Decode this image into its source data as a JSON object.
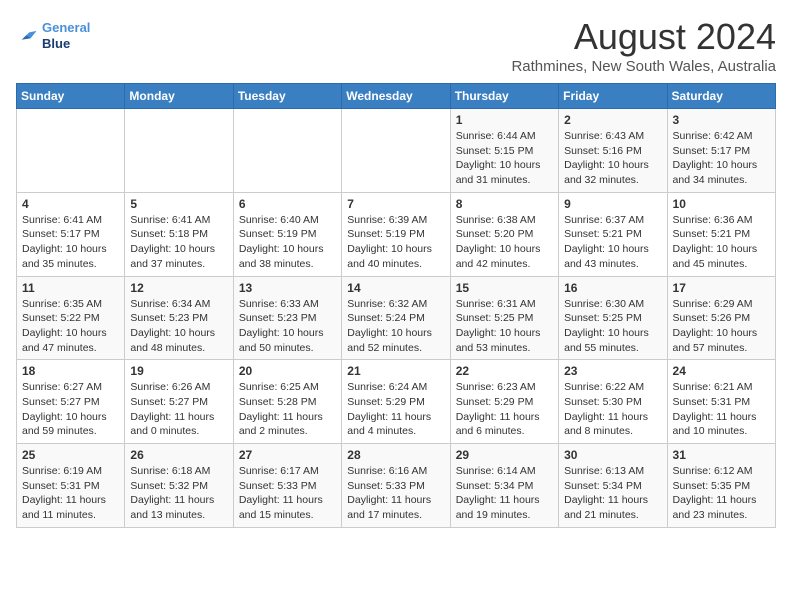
{
  "header": {
    "logo_line1": "General",
    "logo_line2": "Blue",
    "title": "August 2024",
    "subtitle": "Rathmines, New South Wales, Australia"
  },
  "calendar": {
    "days_of_week": [
      "Sunday",
      "Monday",
      "Tuesday",
      "Wednesday",
      "Thursday",
      "Friday",
      "Saturday"
    ],
    "weeks": [
      [
        {
          "day": "",
          "info": ""
        },
        {
          "day": "",
          "info": ""
        },
        {
          "day": "",
          "info": ""
        },
        {
          "day": "",
          "info": ""
        },
        {
          "day": "1",
          "info": "Sunrise: 6:44 AM\nSunset: 5:15 PM\nDaylight: 10 hours\nand 31 minutes."
        },
        {
          "day": "2",
          "info": "Sunrise: 6:43 AM\nSunset: 5:16 PM\nDaylight: 10 hours\nand 32 minutes."
        },
        {
          "day": "3",
          "info": "Sunrise: 6:42 AM\nSunset: 5:17 PM\nDaylight: 10 hours\nand 34 minutes."
        }
      ],
      [
        {
          "day": "4",
          "info": "Sunrise: 6:41 AM\nSunset: 5:17 PM\nDaylight: 10 hours\nand 35 minutes."
        },
        {
          "day": "5",
          "info": "Sunrise: 6:41 AM\nSunset: 5:18 PM\nDaylight: 10 hours\nand 37 minutes."
        },
        {
          "day": "6",
          "info": "Sunrise: 6:40 AM\nSunset: 5:19 PM\nDaylight: 10 hours\nand 38 minutes."
        },
        {
          "day": "7",
          "info": "Sunrise: 6:39 AM\nSunset: 5:19 PM\nDaylight: 10 hours\nand 40 minutes."
        },
        {
          "day": "8",
          "info": "Sunrise: 6:38 AM\nSunset: 5:20 PM\nDaylight: 10 hours\nand 42 minutes."
        },
        {
          "day": "9",
          "info": "Sunrise: 6:37 AM\nSunset: 5:21 PM\nDaylight: 10 hours\nand 43 minutes."
        },
        {
          "day": "10",
          "info": "Sunrise: 6:36 AM\nSunset: 5:21 PM\nDaylight: 10 hours\nand 45 minutes."
        }
      ],
      [
        {
          "day": "11",
          "info": "Sunrise: 6:35 AM\nSunset: 5:22 PM\nDaylight: 10 hours\nand 47 minutes."
        },
        {
          "day": "12",
          "info": "Sunrise: 6:34 AM\nSunset: 5:23 PM\nDaylight: 10 hours\nand 48 minutes."
        },
        {
          "day": "13",
          "info": "Sunrise: 6:33 AM\nSunset: 5:23 PM\nDaylight: 10 hours\nand 50 minutes."
        },
        {
          "day": "14",
          "info": "Sunrise: 6:32 AM\nSunset: 5:24 PM\nDaylight: 10 hours\nand 52 minutes."
        },
        {
          "day": "15",
          "info": "Sunrise: 6:31 AM\nSunset: 5:25 PM\nDaylight: 10 hours\nand 53 minutes."
        },
        {
          "day": "16",
          "info": "Sunrise: 6:30 AM\nSunset: 5:25 PM\nDaylight: 10 hours\nand 55 minutes."
        },
        {
          "day": "17",
          "info": "Sunrise: 6:29 AM\nSunset: 5:26 PM\nDaylight: 10 hours\nand 57 minutes."
        }
      ],
      [
        {
          "day": "18",
          "info": "Sunrise: 6:27 AM\nSunset: 5:27 PM\nDaylight: 10 hours\nand 59 minutes."
        },
        {
          "day": "19",
          "info": "Sunrise: 6:26 AM\nSunset: 5:27 PM\nDaylight: 11 hours\nand 0 minutes."
        },
        {
          "day": "20",
          "info": "Sunrise: 6:25 AM\nSunset: 5:28 PM\nDaylight: 11 hours\nand 2 minutes."
        },
        {
          "day": "21",
          "info": "Sunrise: 6:24 AM\nSunset: 5:29 PM\nDaylight: 11 hours\nand 4 minutes."
        },
        {
          "day": "22",
          "info": "Sunrise: 6:23 AM\nSunset: 5:29 PM\nDaylight: 11 hours\nand 6 minutes."
        },
        {
          "day": "23",
          "info": "Sunrise: 6:22 AM\nSunset: 5:30 PM\nDaylight: 11 hours\nand 8 minutes."
        },
        {
          "day": "24",
          "info": "Sunrise: 6:21 AM\nSunset: 5:31 PM\nDaylight: 11 hours\nand 10 minutes."
        }
      ],
      [
        {
          "day": "25",
          "info": "Sunrise: 6:19 AM\nSunset: 5:31 PM\nDaylight: 11 hours\nand 11 minutes."
        },
        {
          "day": "26",
          "info": "Sunrise: 6:18 AM\nSunset: 5:32 PM\nDaylight: 11 hours\nand 13 minutes."
        },
        {
          "day": "27",
          "info": "Sunrise: 6:17 AM\nSunset: 5:33 PM\nDaylight: 11 hours\nand 15 minutes."
        },
        {
          "day": "28",
          "info": "Sunrise: 6:16 AM\nSunset: 5:33 PM\nDaylight: 11 hours\nand 17 minutes."
        },
        {
          "day": "29",
          "info": "Sunrise: 6:14 AM\nSunset: 5:34 PM\nDaylight: 11 hours\nand 19 minutes."
        },
        {
          "day": "30",
          "info": "Sunrise: 6:13 AM\nSunset: 5:34 PM\nDaylight: 11 hours\nand 21 minutes."
        },
        {
          "day": "31",
          "info": "Sunrise: 6:12 AM\nSunset: 5:35 PM\nDaylight: 11 hours\nand 23 minutes."
        }
      ]
    ]
  }
}
